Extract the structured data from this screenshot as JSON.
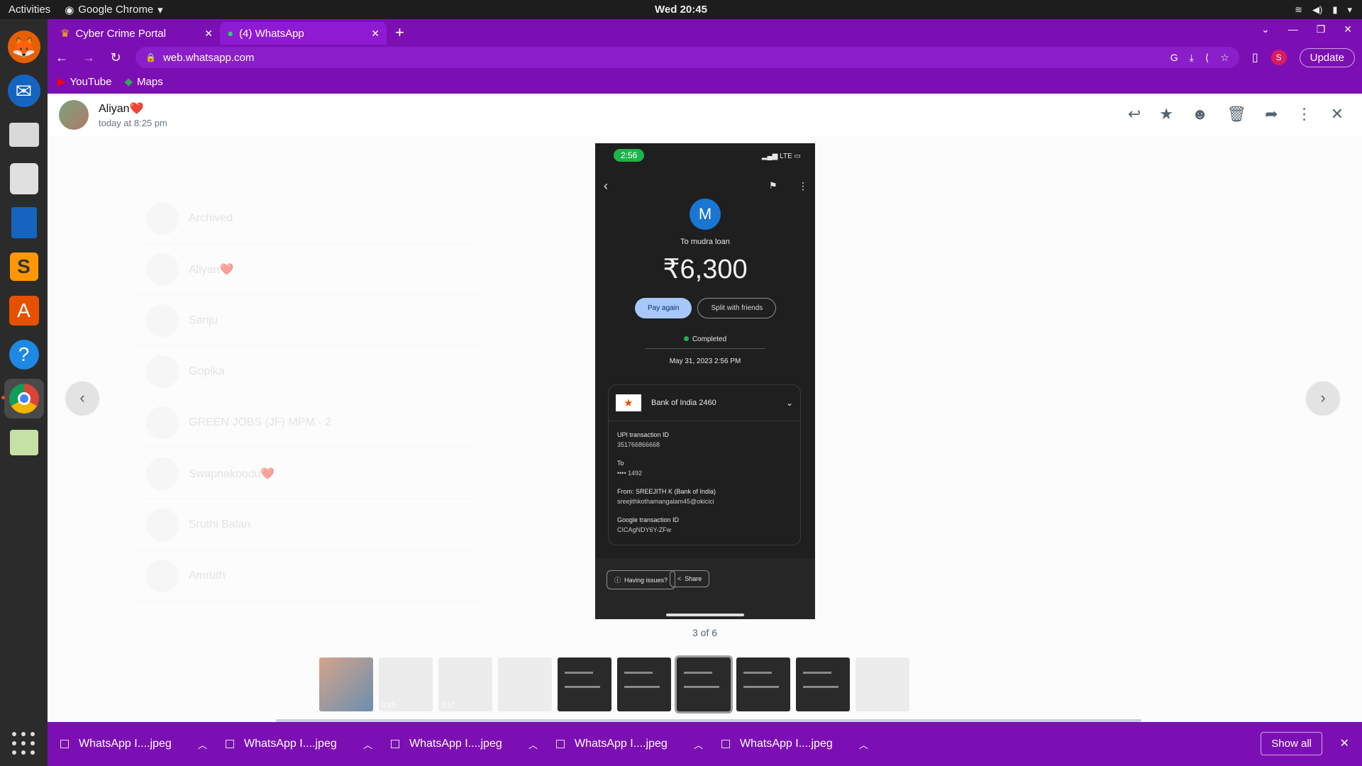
{
  "os": {
    "activities": "Activities",
    "app_name": "Google Chrome",
    "clock": "Wed 20:45"
  },
  "chrome": {
    "tabs": [
      {
        "title": "Cyber Crime Portal"
      },
      {
        "title": "(4) WhatsApp"
      }
    ],
    "url": "web.whatsapp.com",
    "profile_initial": "S",
    "update_label": "Update",
    "bookmarks": [
      {
        "label": "YouTube"
      },
      {
        "label": "Maps"
      }
    ]
  },
  "viewer": {
    "sender_name": "Aliyan❤️",
    "sender_time": "today at 8:25 pm",
    "counter": "3 of 6",
    "background_list": [
      {
        "name": "Archived"
      },
      {
        "name": "Aliyan❤️"
      },
      {
        "name": "Sanju"
      },
      {
        "name": "Gopika"
      },
      {
        "name": "GREEN JOBS (JF) MPM - 2"
      },
      {
        "name": "Swapnakoodu❤️"
      },
      {
        "name": "Sruthi Balan"
      },
      {
        "name": "Amruth"
      }
    ],
    "thumbs": [
      {
        "kind": "photo",
        "duration": ""
      },
      {
        "kind": "light",
        "duration": "0:25"
      },
      {
        "kind": "light",
        "duration": "0:17"
      },
      {
        "kind": "light",
        "duration": ""
      },
      {
        "kind": "dark",
        "duration": ""
      },
      {
        "kind": "dark",
        "duration": ""
      },
      {
        "kind": "dark",
        "duration": "",
        "selected": true
      },
      {
        "kind": "dark",
        "duration": ""
      },
      {
        "kind": "dark",
        "duration": ""
      },
      {
        "kind": "light",
        "duration": ""
      }
    ]
  },
  "payment": {
    "status_time": "2:56",
    "network": "LTE",
    "avatar_letter": "M",
    "to_label": "To mudra loan",
    "amount": "₹6,300",
    "pay_again": "Pay again",
    "split": "Split with friends",
    "status": "Completed",
    "date": "May 31, 2023 2:56 PM",
    "bank": "Bank of India 2460",
    "upi_label": "UPI transaction ID",
    "upi_value": "351766866668",
    "to_field_label": "To",
    "to_field_value": "•••• 1492",
    "from_label": "From: SREEJITH K (Bank of India)",
    "from_value": "sreejithkothamangalam45@okicici",
    "gtid_label": "Google transaction ID",
    "gtid_value": "CICAgNDY6Y-ZFw",
    "issues_label": "Having issues?",
    "share_label": "Share"
  },
  "downloads": {
    "items": [
      {
        "name": "WhatsApp I....jpeg"
      },
      {
        "name": "WhatsApp I....jpeg"
      },
      {
        "name": "WhatsApp I....jpeg"
      },
      {
        "name": "WhatsApp I....jpeg"
      },
      {
        "name": "WhatsApp I....jpeg"
      }
    ],
    "show_all": "Show all"
  }
}
